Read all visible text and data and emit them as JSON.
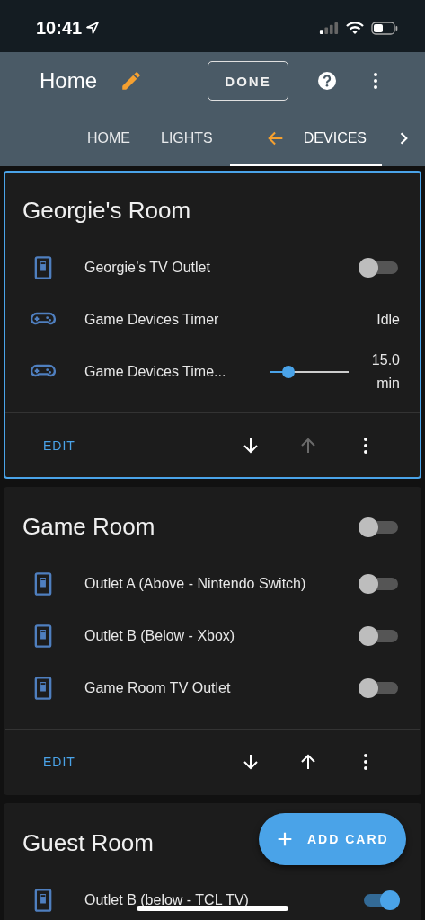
{
  "status_bar": {
    "time": "10:41"
  },
  "header": {
    "title": "Home",
    "done_label": "DONE"
  },
  "tabs": [
    {
      "label": "HOME",
      "selected": false,
      "move_arrow": false
    },
    {
      "label": "LIGHTS",
      "selected": false,
      "move_arrow": false
    },
    {
      "label": "DEVICES",
      "selected": true,
      "move_arrow": true
    }
  ],
  "cards": [
    {
      "title": "Georgie's Room",
      "selected": true,
      "rows": [
        {
          "kind": "toggle",
          "name": "Georgie’s TV Outlet",
          "on": false
        },
        {
          "kind": "state",
          "name": "Game Devices Timer",
          "state": "Idle"
        },
        {
          "kind": "slider",
          "name": "Game Devices Time...",
          "level": 0.24,
          "value": "15.0",
          "unit": "min"
        }
      ],
      "footer": {
        "edit": "EDIT",
        "down_disabled": false,
        "up_disabled": true
      }
    },
    {
      "title": "Game Room",
      "selected": false,
      "header_toggle": {
        "on": false
      },
      "rows": [
        {
          "kind": "toggle",
          "name": "Outlet A (Above - Nintendo Switch)",
          "on": false
        },
        {
          "kind": "toggle",
          "name": "Outlet B (Below - Xbox)",
          "on": false
        },
        {
          "kind": "toggle",
          "name": "Game Room TV Outlet",
          "on": false
        }
      ],
      "footer": {
        "edit": "EDIT",
        "down_disabled": false,
        "up_disabled": false
      }
    },
    {
      "title": "Guest Room",
      "selected": false,
      "rows": [
        {
          "kind": "toggle",
          "name": "Outlet B (below - TCL TV)",
          "on": true
        }
      ]
    }
  ],
  "fab": {
    "label": "ADD CARD"
  }
}
